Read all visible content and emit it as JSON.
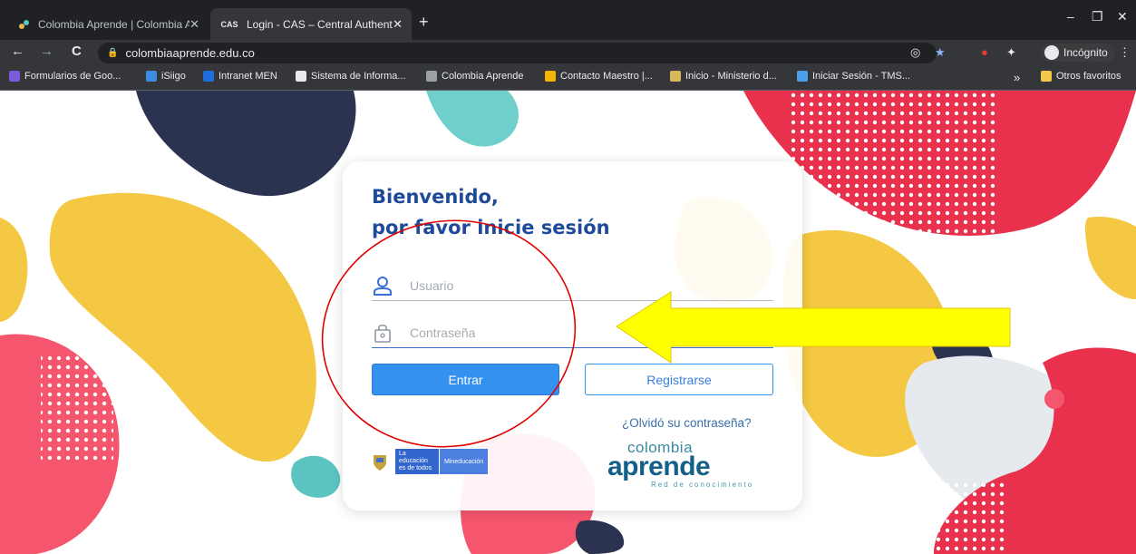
{
  "browser": {
    "tabs": [
      {
        "label": "Colombia Aprende | Colombia Ap",
        "close": "✕"
      },
      {
        "label": "Login - CAS – Central Authenticat",
        "close": "✕",
        "favicon": "CAS"
      }
    ],
    "new_tab": "+",
    "window": {
      "minimize": "–",
      "restore": "❐",
      "close": "✕"
    },
    "nav": {
      "back": "←",
      "forward": "→",
      "reload": "C"
    },
    "url": "colombiaaprende.edu.co",
    "incognito_label": "Incógnito",
    "bookmarks": [
      {
        "label": "Formularios de Goo...",
        "color": "#7b5cd6"
      },
      {
        "label": "iSiigo",
        "color": "#3b8de0"
      },
      {
        "label": "Intranet MEN",
        "color": "#1e6fd9"
      },
      {
        "label": "Sistema de Informa...",
        "color": "#e8eaed"
      },
      {
        "label": "Colombia Aprende",
        "color": "#9aa0a6"
      },
      {
        "label": "Contacto Maestro |...",
        "color": "#f2b400"
      },
      {
        "label": "Inicio - Ministerio d...",
        "color": "#d9b65a"
      },
      {
        "label": "Iniciar Sesión - TMS...",
        "color": "#4a9fe8"
      }
    ],
    "more_bookmarks": "»",
    "other_bookmarks": "Otros favoritos"
  },
  "login": {
    "title_line1": "Bienvenido,",
    "title_line2": "por favor inicie sesión",
    "username_placeholder": "Usuario",
    "password_placeholder": "Contraseña",
    "login_button": "Entrar",
    "register_button": "Registrarse",
    "forgot_link": "¿Olvidó su contraseña?",
    "men_logo_text": "La educación es de todos",
    "men_logo_brand": "Mineducación",
    "logo_top": "colombia",
    "logo_main": "aprende",
    "logo_sub": "Red de conocimiento"
  },
  "colors": {
    "accent": "#3491f0",
    "title": "#1f4a9a",
    "annotation_arrow": "#ffff00",
    "annotation_circle": "#e00000"
  }
}
